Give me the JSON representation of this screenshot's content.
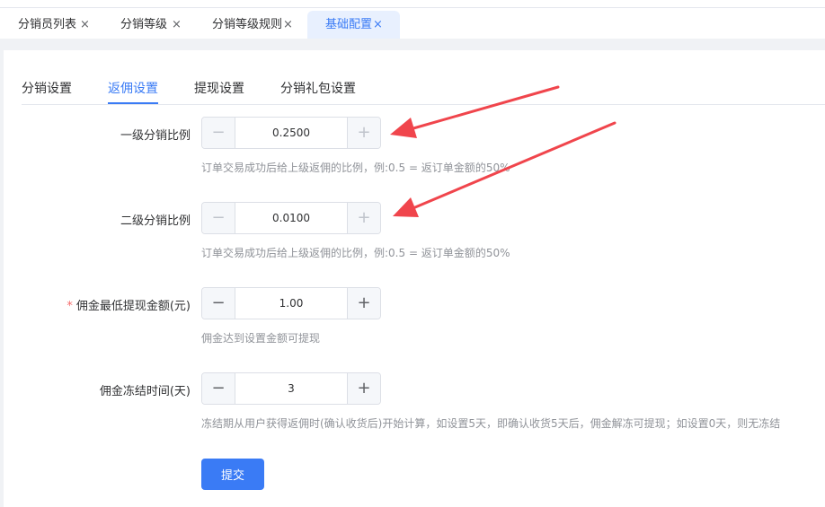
{
  "tabs": [
    {
      "label": "分销员列表",
      "close": "×"
    },
    {
      "label": "分销等级",
      "close": "×"
    },
    {
      "label": "分销等级规则",
      "close": "×"
    },
    {
      "label": "基础配置",
      "close": "×",
      "active": true
    }
  ],
  "subtabs": [
    "分销设置",
    "返佣设置",
    "提现设置",
    "分销礼包设置"
  ],
  "active_subtab": "返佣设置",
  "form": {
    "level1": {
      "label": "一级分销比例",
      "value": "0.2500",
      "minus": "−",
      "plus": "+",
      "hint": "订单交易成功后给上级返佣的比例，例:0.5 = 返订单金额的50%"
    },
    "level2": {
      "label": "二级分销比例",
      "value": "0.0100",
      "minus": "−",
      "plus": "+",
      "hint": "订单交易成功后给上级返佣的比例，例:0.5 = 返订单金额的50%"
    },
    "min_withdraw": {
      "required_mark": "*",
      "label": "佣金最低提现金额(元)",
      "value": "1.00",
      "minus": "−",
      "plus": "+",
      "hint": "佣金达到设置金额可提现"
    },
    "freeze_days": {
      "label": "佣金冻结时间(天)",
      "value": "3",
      "minus": "−",
      "plus": "+",
      "hint": "冻结期从用户获得返佣时(确认收货后)开始计算，如设置5天，即确认收货5天后，佣金解冻可提现；如设置0天，则无冻结"
    },
    "submit_label": "提交"
  },
  "colors": {
    "accent": "#3a7bf5",
    "annotation_arrow": "#f0454c",
    "required": "#f56c6c"
  }
}
